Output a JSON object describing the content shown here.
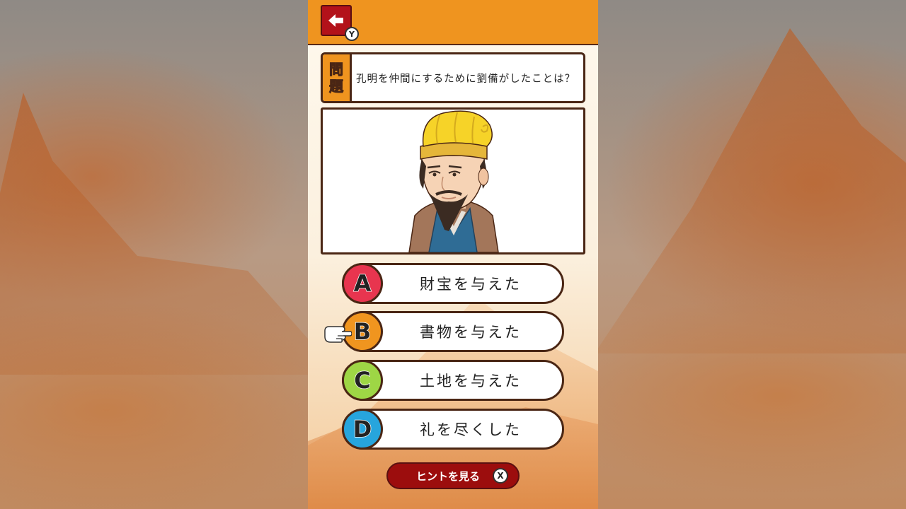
{
  "header": {
    "back_icon": "left-arrow-icon",
    "back_button_key": "Y"
  },
  "question": {
    "tag_line1": "問",
    "tag_line2": "題",
    "text": "孔明を仲間にするために劉備がしたことは？"
  },
  "portrait": {
    "subject": "character-portrait"
  },
  "answers": [
    {
      "letter": "A",
      "label": "財宝を与えた",
      "color": "#e8354f"
    },
    {
      "letter": "B",
      "label": "書物を与えた",
      "color": "#f0951f"
    },
    {
      "letter": "C",
      "label": "土地を与えた",
      "color": "#9ed645"
    },
    {
      "letter": "D",
      "label": "礼を尽くした",
      "color": "#27a5dd"
    }
  ],
  "selected_answer": "B",
  "hint": {
    "label": "ヒントを見る",
    "key": "X"
  },
  "colors": {
    "header_orange": "#ef941f",
    "button_red": "#b3121a",
    "hint_red": "#9c0d0d",
    "outline_brown": "#4a2614"
  }
}
